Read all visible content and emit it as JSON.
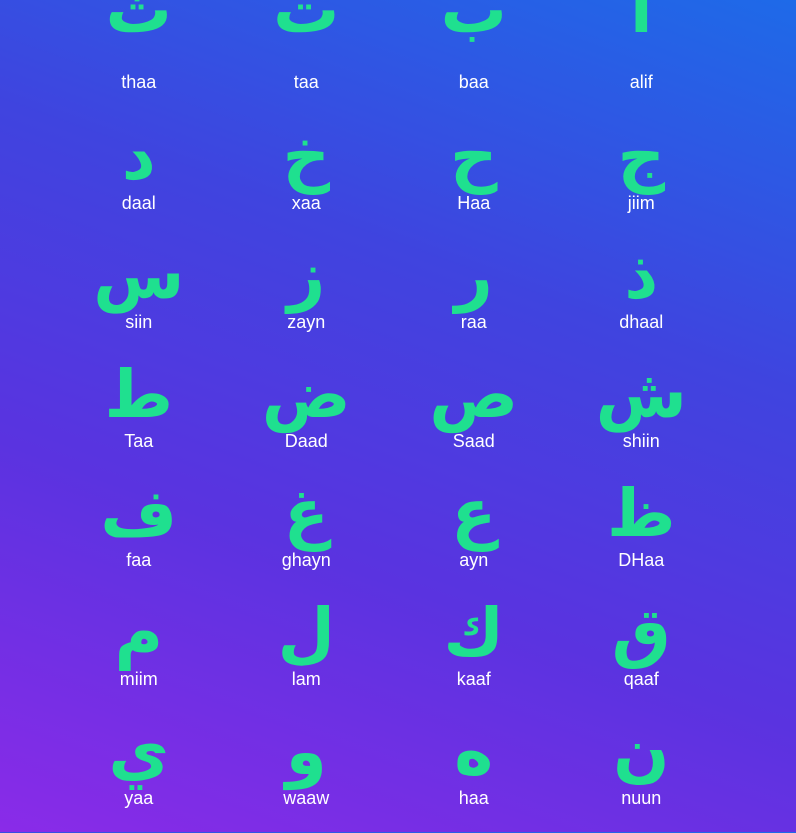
{
  "colors": {
    "accent": "#1fe08f",
    "text": "#ffffff"
  },
  "rows": [
    [
      {
        "letter": "ث",
        "name": "thaa"
      },
      {
        "letter": "ت",
        "name": "taa"
      },
      {
        "letter": "ب",
        "name": "baa"
      },
      {
        "letter": "ا",
        "name": "alif"
      }
    ],
    [
      {
        "letter": "د",
        "name": "daal"
      },
      {
        "letter": "خ",
        "name": "xaa"
      },
      {
        "letter": "ح",
        "name": "Haa"
      },
      {
        "letter": "ج",
        "name": "jiim"
      }
    ],
    [
      {
        "letter": "س",
        "name": "siin"
      },
      {
        "letter": "ز",
        "name": "zayn"
      },
      {
        "letter": "ر",
        "name": "raa"
      },
      {
        "letter": "ذ",
        "name": "dhaal"
      }
    ],
    [
      {
        "letter": "ط",
        "name": "Taa"
      },
      {
        "letter": "ض",
        "name": "Daad"
      },
      {
        "letter": "ص",
        "name": "Saad"
      },
      {
        "letter": "ش",
        "name": "shiin"
      }
    ],
    [
      {
        "letter": "ف",
        "name": "faa"
      },
      {
        "letter": "غ",
        "name": "ghayn"
      },
      {
        "letter": "ع",
        "name": "ayn"
      },
      {
        "letter": "ظ",
        "name": "DHaa"
      }
    ],
    [
      {
        "letter": "م",
        "name": "miim"
      },
      {
        "letter": "ل",
        "name": "lam"
      },
      {
        "letter": "ك",
        "name": "kaaf"
      },
      {
        "letter": "ق",
        "name": "qaaf"
      }
    ],
    [
      {
        "letter": "ي",
        "name": "yaa"
      },
      {
        "letter": "و",
        "name": "waaw"
      },
      {
        "letter": "ه",
        "name": "haa"
      },
      {
        "letter": "ن",
        "name": "nuun"
      }
    ]
  ]
}
